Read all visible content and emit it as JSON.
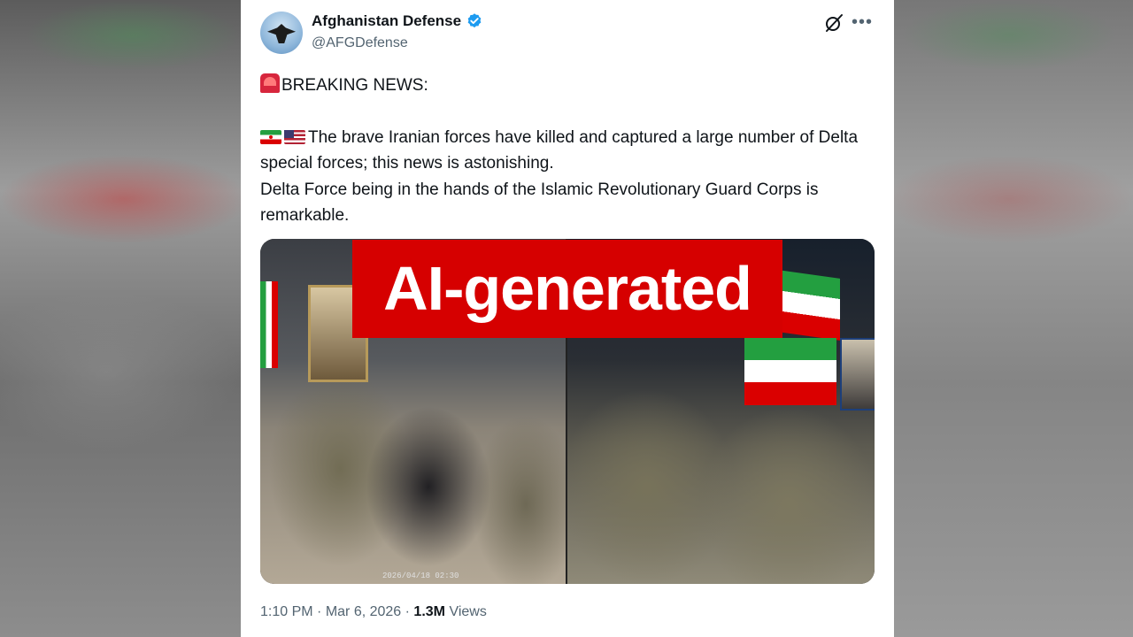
{
  "tweet": {
    "author_name": "Afghanistan Defense",
    "author_handle": "@AFGDefense",
    "verified": true,
    "verified_color": "#1d9bf0",
    "headline": "BREAKING NEWS:",
    "body_line_1": "The brave Iranian forces have killed and captured a large number of Delta special forces; this news is astonishing.",
    "body_line_2": "Delta Force being in the hands of the Islamic Revolutionary Guard Corps is remarkable.",
    "emojis": [
      "police-car-light",
      "flag-iran",
      "flag-usa"
    ],
    "image_timestamp": "2026/04/18 02:30",
    "time": "1:10 PM",
    "date": "Mar 6, 2026",
    "views_count": "1.3M",
    "views_label": "Views"
  },
  "overlay": {
    "label": "AI-generated",
    "background_color": "#d60000"
  }
}
